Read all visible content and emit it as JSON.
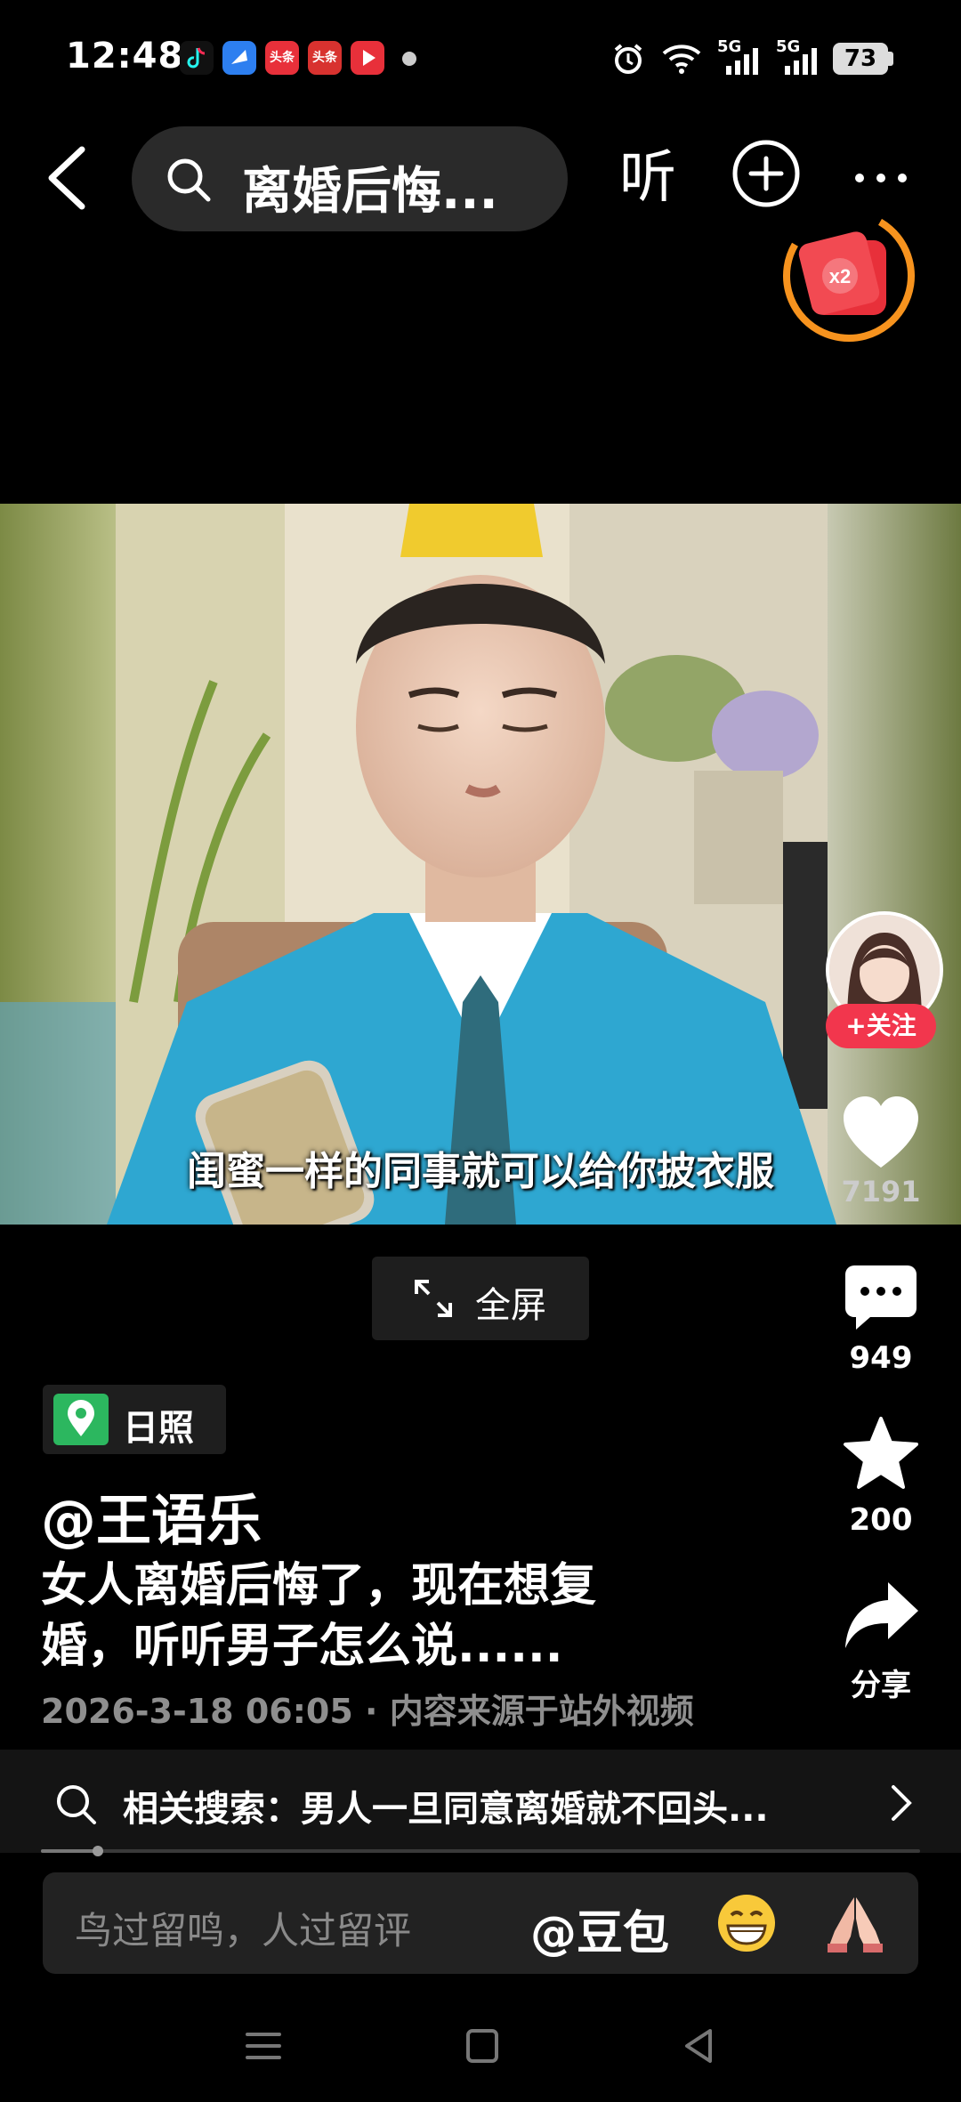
{
  "status_bar": {
    "time": "12:48",
    "app_icons": [
      {
        "name": "tiktok-icon",
        "label": "",
        "color": "#111111"
      },
      {
        "name": "blue-app-icon",
        "label": "",
        "color": "#2d7ff0"
      },
      {
        "name": "toutiao-icon",
        "label": "头条",
        "color": "#e8303a"
      },
      {
        "name": "toutiao-lite-icon",
        "label": "头条",
        "color": "#d8322f"
      },
      {
        "name": "video-app-icon",
        "label": "",
        "color": "#e8303a"
      }
    ],
    "network_1": "5G",
    "network_2": "5G",
    "battery": "73"
  },
  "top_nav": {
    "search_query": "离婚后悔...",
    "listen_label": "听",
    "reward_multiplier": "x2"
  },
  "video": {
    "subtitle": "闺蜜一样的同事就可以给你披衣服"
  },
  "right_rail": {
    "follow_label": "+关注",
    "like_count": "7191",
    "comment_count": "949",
    "favorite_count": "200",
    "share_label": "分享"
  },
  "fullscreen_label": "全屏",
  "info": {
    "location": "日照",
    "author": "@王语乐",
    "title": "女人离婚后悔了，现在想复婚，听听男子怎么说......",
    "meta": "2026-3-18 06:05 · 内容来源于站外视频"
  },
  "related": {
    "text": "相关搜索：男人一旦同意离婚就不回头..."
  },
  "playback_progress": 0.065,
  "comment_input": {
    "placeholder": "鸟过留鸣，人过留评",
    "mention": "@豆包"
  },
  "colors": {
    "follow": "#f2364d",
    "location_pin": "#2cb75f",
    "reward_ring": "#f7931e",
    "reward_badge": "#e8303a"
  }
}
